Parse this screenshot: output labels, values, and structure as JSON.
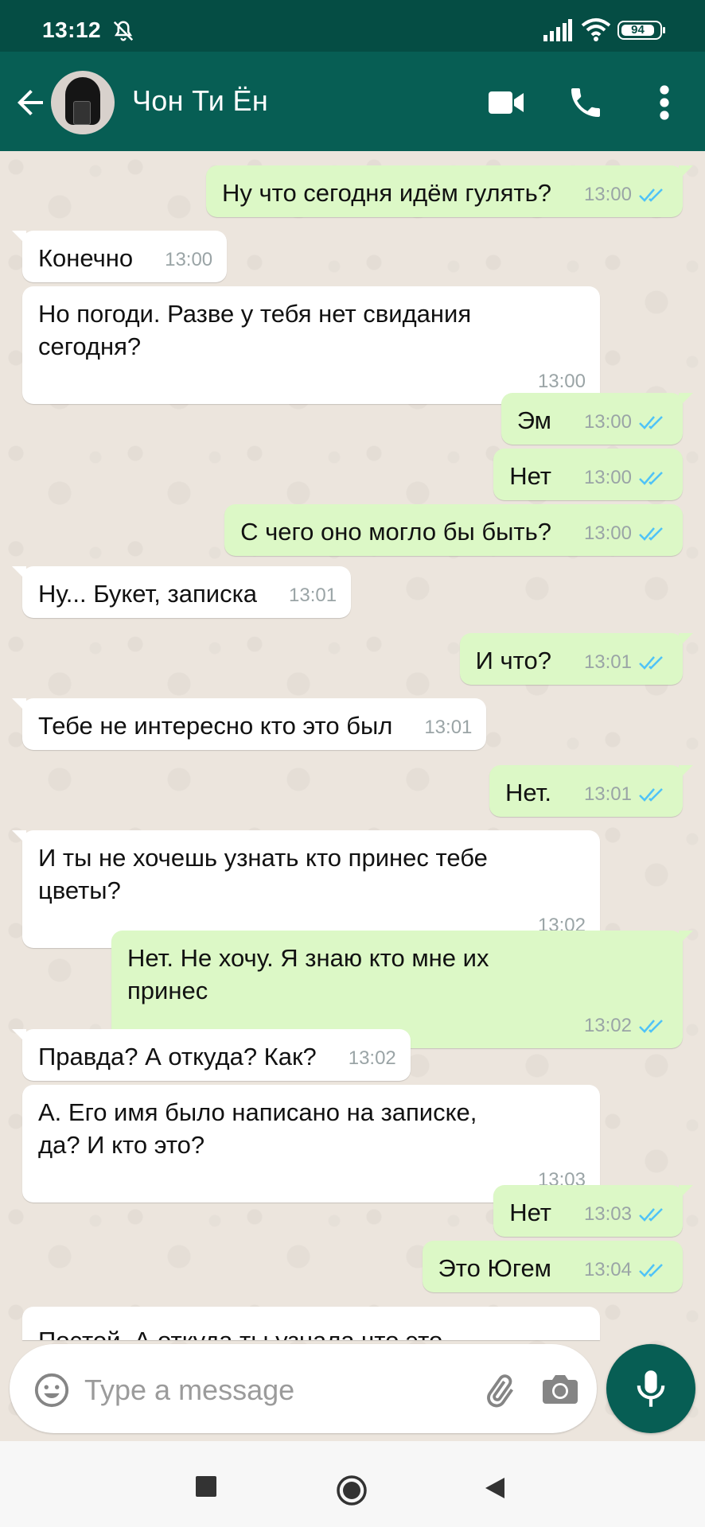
{
  "status_bar": {
    "time": "13:12",
    "battery": "94"
  },
  "header": {
    "contact_name": "Чон Ти Ён"
  },
  "messages": [
    {
      "dir": "out",
      "text": "Ну что сегодня идём гулять?",
      "time": "13:00",
      "read": true,
      "first": true
    },
    {
      "dir": "in",
      "text": "Конечно",
      "time": "13:00",
      "first": true
    },
    {
      "dir": "in",
      "text": "Но погоди. Разве у тебя нет свидания\nсегодня?",
      "time": "13:00"
    },
    {
      "dir": "out",
      "text": "Эм",
      "time": "13:00",
      "read": true,
      "first": true
    },
    {
      "dir": "out",
      "text": "Нет",
      "time": "13:00",
      "read": true
    },
    {
      "dir": "out",
      "text": "С чего оно могло бы быть?",
      "time": "13:00",
      "read": true
    },
    {
      "dir": "in",
      "text": "Ну... Букет, записка",
      "time": "13:01",
      "first": true
    },
    {
      "dir": "out",
      "text": "И что?",
      "time": "13:01",
      "read": true,
      "first": true
    },
    {
      "dir": "in",
      "text": "Тебе не интересно кто это был",
      "time": "13:01",
      "first": true
    },
    {
      "dir": "out",
      "text": "Нет.",
      "time": "13:01",
      "read": true,
      "first": true
    },
    {
      "dir": "in",
      "text": "И ты не хочешь узнать кто принес тебе\nцветы?",
      "time": "13:02",
      "first": true
    },
    {
      "dir": "out",
      "text": "Нет. Не хочу. Я знаю кто мне их\nпринес",
      "time": "13:02",
      "read": true,
      "first": true
    },
    {
      "dir": "in",
      "text": "Правда? А откуда? Как?",
      "time": "13:02",
      "first": true
    },
    {
      "dir": "in",
      "text": "А. Его имя было написано на записке,\nда? И кто это?",
      "time": "13:03"
    },
    {
      "dir": "out",
      "text": "Нет",
      "time": "13:03",
      "read": true,
      "first": true
    },
    {
      "dir": "out",
      "text": "Это Югем",
      "time": "13:04",
      "read": true
    }
  ],
  "partial_message": "Постой. А откуда ты узнала что это",
  "composer": {
    "placeholder": "Type a message"
  },
  "colors": {
    "header": "#075e54",
    "status_bar": "#054d44",
    "outgoing": "#dcf8c6",
    "incoming": "#ffffff",
    "read_ticks": "#4fc3f7"
  },
  "icons": [
    "back-arrow-icon",
    "video-icon",
    "call-icon",
    "more-vert-icon",
    "emoji-icon",
    "attach-icon",
    "camera-icon",
    "mic-icon",
    "mute-icon",
    "signal-icon",
    "wifi-icon"
  ]
}
